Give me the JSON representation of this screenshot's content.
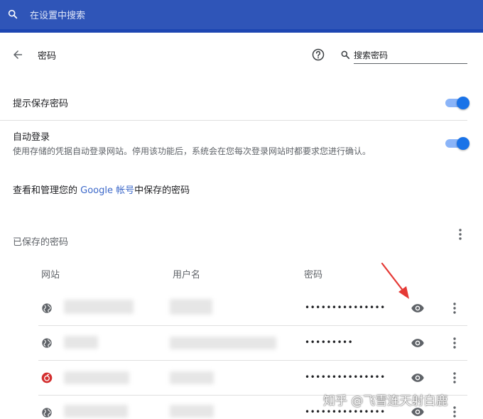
{
  "search_bar": {
    "placeholder": "在设置中搜索"
  },
  "header": {
    "title": "密码",
    "search_placeholder": "搜索密码"
  },
  "settings": {
    "offer_to_save": {
      "label": "提示保存密码",
      "enabled": true
    },
    "auto_signin": {
      "label": "自动登录",
      "description": "使用存储的凭据自动登录网站。停用该功能后，系统会在您每次登录网站时都要求您进行确认。",
      "enabled": true
    }
  },
  "manage": {
    "prefix": "查看和管理您的 ",
    "link": "Google 帐号",
    "suffix": "中保存的密码"
  },
  "saved_passwords": {
    "title": "已保存的密码",
    "columns": {
      "site": "网站",
      "username": "用户名",
      "password": "密码"
    },
    "rows": [
      {
        "site_icon": "globe-icon",
        "password": "•••••••••••••••"
      },
      {
        "site_icon": "globe-icon",
        "password": "•••••••••"
      },
      {
        "site_icon": "netease-music-icon",
        "password": "•••••••••••••••"
      },
      {
        "site_icon": "globe-icon",
        "password": "•••••••••••••••"
      }
    ]
  },
  "watermark": "知乎 @飞雪连天射白鹿",
  "colors": {
    "accent": "#1a73e8",
    "topbar": "#2f55b8",
    "arrow": "#e53935"
  }
}
